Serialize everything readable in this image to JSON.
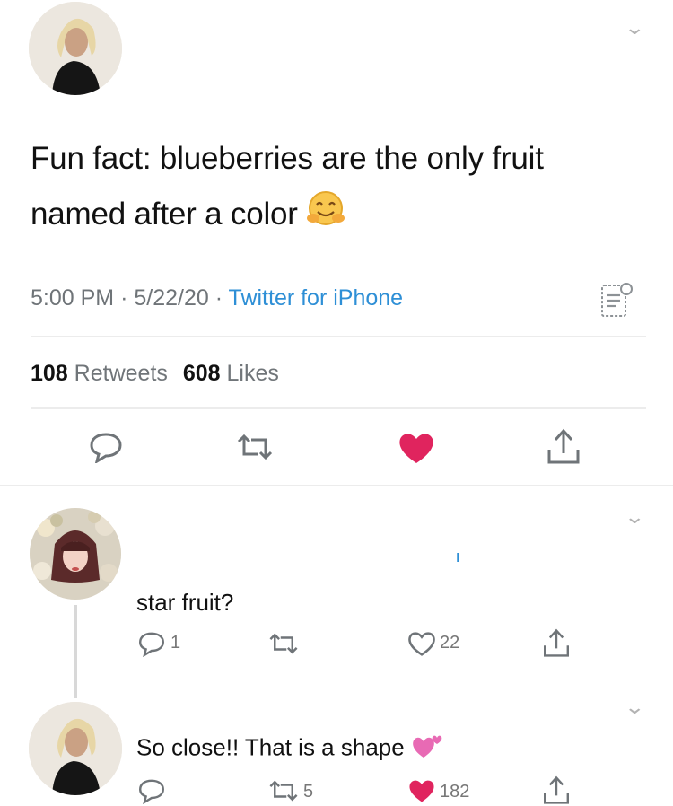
{
  "tweet": {
    "text_line1": "Fun fact: blueberries are the only fruit",
    "text_line2": "named after a color",
    "emoji": "hugging-face-emoji",
    "time": "5:00 PM",
    "date": "5/22/20",
    "source": "Twitter for iPhone",
    "separator": "·",
    "retweets_count": "108",
    "retweets_label": "Retweets",
    "likes_count": "608",
    "likes_label": "Likes"
  },
  "reply1": {
    "text": "star fruit?",
    "reply_count": "1",
    "like_count": "22",
    "marker": "ı"
  },
  "reply2": {
    "text": "So close!! That is a shape",
    "emoji": "two-hearts-emoji",
    "retweet_count": "5",
    "like_count": "182"
  },
  "colors": {
    "like_red": "#e0245e",
    "link_blue": "#2e8fd6",
    "icon_gray": "#6f7478"
  }
}
